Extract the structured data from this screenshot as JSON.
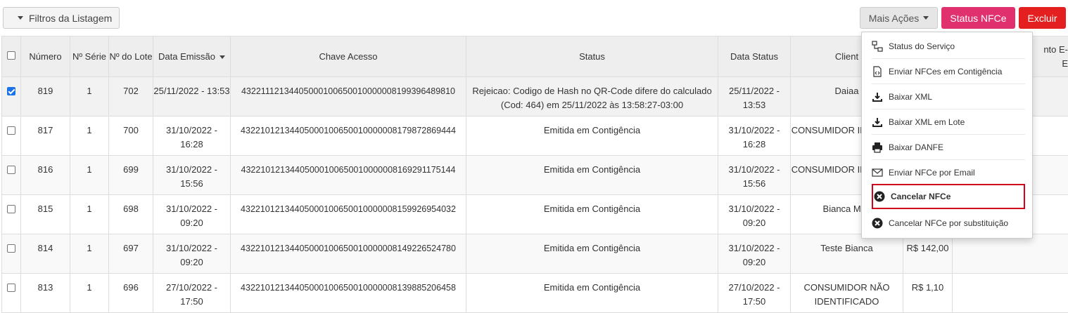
{
  "toolbar": {
    "filter_label": "Filtros da Listagem",
    "mais_acoes_label": "Mais Ações",
    "status_nfce_label": "Status NFCe",
    "excluir_label": "Excluir"
  },
  "colors": {
    "status_button": "#e0306d",
    "excluir_button": "#e41f1f",
    "checkbox_checked": "#1a73e8",
    "highlight_border": "#d0021b"
  },
  "table": {
    "headers": {
      "numero": "Número",
      "serie": "Nº Série",
      "lote": "Nº do Lote",
      "data_emissao": "Data Emissão",
      "chave": "Chave Acesso",
      "status": "Status",
      "data_status": "Data Status",
      "cliente": "Client",
      "valor": "",
      "extra": "nto E-\nE"
    },
    "rows": [
      {
        "checked": true,
        "numero": "819",
        "serie": "1",
        "lote": "702",
        "data_emissao": "25/11/2022 - 13:53",
        "chave": "43221112134405000100650010000008199396489810",
        "status": "Rejeicao: Codigo de Hash no QR-Code difere do calculado (Cod: 464) em 25/11/2022 às 13:58:27-03:00",
        "data_status": "25/11/2022 - 13:53",
        "cliente": "Daiaa",
        "valor": ""
      },
      {
        "checked": false,
        "numero": "817",
        "serie": "1",
        "lote": "700",
        "data_emissao": "31/10/2022 - 16:28",
        "chave": "43221012134405000100650010000008179872869444",
        "status": "Emitida em Contigência",
        "data_status": "31/10/2022 - 16:28",
        "cliente": "CONSUMIDOR IDENTIFIC",
        "valor": ""
      },
      {
        "checked": false,
        "numero": "816",
        "serie": "1",
        "lote": "699",
        "data_emissao": "31/10/2022 - 15:56",
        "chave": "43221012134405000100650010000008169291175144",
        "status": "Emitida em Contigência",
        "data_status": "31/10/2022 - 15:56",
        "cliente": "CONSUMIDOR IDENTIFIC",
        "valor": ""
      },
      {
        "checked": false,
        "numero": "815",
        "serie": "1",
        "lote": "698",
        "data_emissao": "31/10/2022 - 09:20",
        "chave": "43221012134405000100650010000008159926954032",
        "status": "Emitida em Contigência",
        "data_status": "31/10/2022 - 09:20",
        "cliente": "Bianca Mas",
        "valor": ""
      },
      {
        "checked": false,
        "numero": "814",
        "serie": "1",
        "lote": "697",
        "data_emissao": "31/10/2022 - 09:20",
        "chave": "43221012134405000100650010000008149226524780",
        "status": "Emitida em Contigência",
        "data_status": "31/10/2022 - 09:20",
        "cliente": "Teste Bianca",
        "valor": "R$ 142,00"
      },
      {
        "checked": false,
        "numero": "813",
        "serie": "1",
        "lote": "696",
        "data_emissao": "27/10/2022 - 17:50",
        "chave": "43221012134405000100650010000008139885206458",
        "status": "Emitida em Contigência",
        "data_status": "27/10/2022 - 17:50",
        "cliente": "CONSUMIDOR NÃO IDENTIFICADO",
        "valor": "R$ 1,10"
      }
    ]
  },
  "dropdown": {
    "items": [
      {
        "label": "Status do Serviço",
        "icon": "network-icon"
      },
      {
        "label": "Enviar NFCes em Contigência",
        "icon": "document-code-icon"
      },
      {
        "label": "Baixar XML",
        "icon": "download-icon"
      },
      {
        "label": "Baixar XML em Lote",
        "icon": "download-icon"
      },
      {
        "label": "Baixar DANFE",
        "icon": "printer-icon"
      },
      {
        "label": "Enviar NFCe por Email",
        "icon": "envelope-icon"
      },
      {
        "label": "Cancelar NFCe",
        "icon": "cancel-circle-icon"
      },
      {
        "label": "Cancelar NFCe por substituição",
        "icon": "cancel-circle-icon"
      }
    ]
  }
}
